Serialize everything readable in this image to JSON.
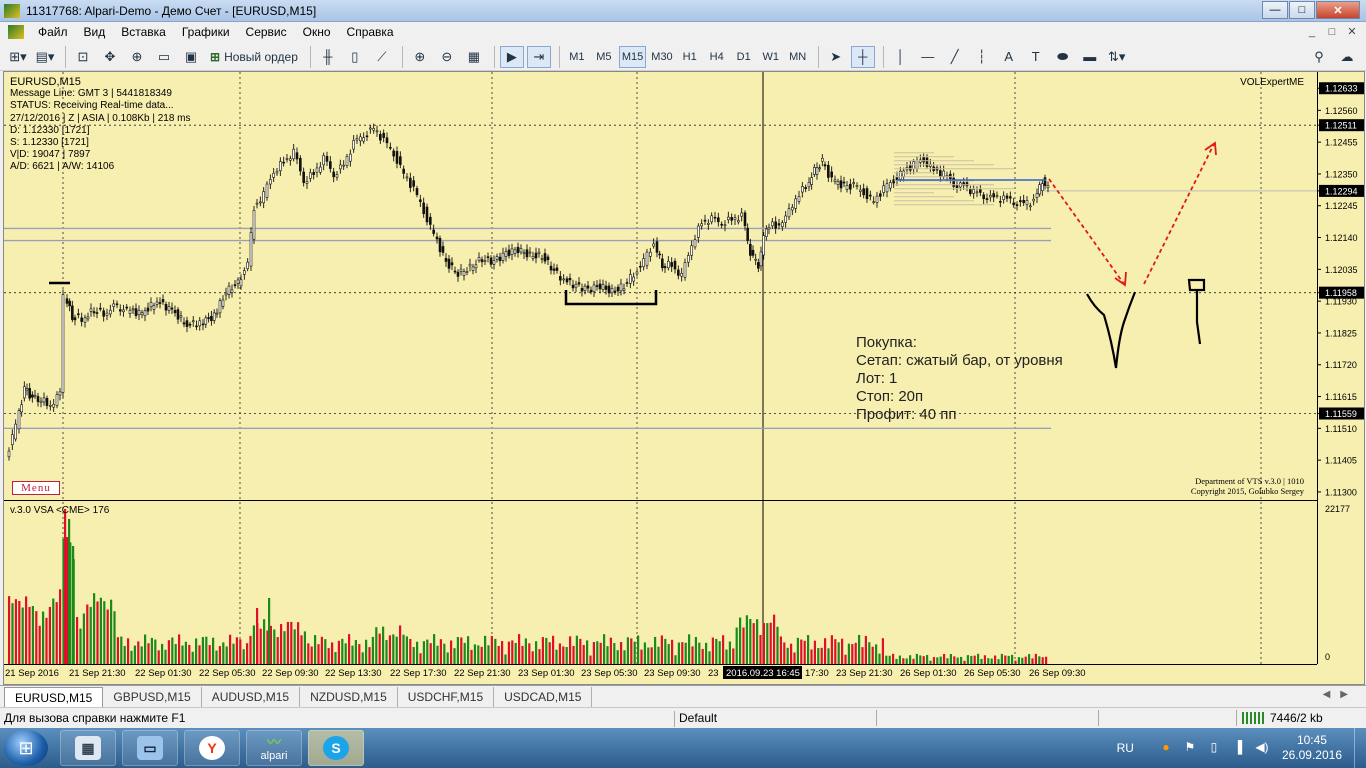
{
  "window": {
    "title": "11317768: Alpari-Demo - Демо Счет - [EURUSD,M15]",
    "btn_min": "—",
    "btn_max": "□",
    "btn_close": "✕"
  },
  "menu": [
    "Файл",
    "Вид",
    "Вставка",
    "Графики",
    "Сервис",
    "Окно",
    "Справка"
  ],
  "mdi_buttons": [
    "_",
    "□",
    "✕"
  ],
  "toolbar": {
    "new_order": "Новый ордер",
    "timeframes": [
      "M1",
      "M5",
      "M15",
      "M30",
      "H1",
      "H4",
      "D1",
      "W1",
      "MN"
    ],
    "active_timeframe": "M15"
  },
  "chart": {
    "symbol_label": "EURUSD,M15",
    "info_lines": [
      "Message Line: GMT 3  | 5441818349",
      "STATUS:  Receiving Real-time data...",
      "27/12/2016 | Z | ASIA | 0.108Kb | 218 ms",
      "D: 1.12330  [1721]",
      "S: 1.12330  [1721]",
      "V|D: 19047 | 7897",
      "A/D: 6621  | A/W: 14106"
    ],
    "expert_label": "VOLExpertME",
    "menu_button": "Menu",
    "dept_line1": "Department of VTS  v.3.0 | 1010",
    "dept_line2": "Copyright 2015, Golubko Sergey",
    "trade_note": [
      "Покупка:",
      "Сетап: сжатый бар, от уровня",
      "Лот: 1",
      "Стоп: 20п",
      "Профит: 40 пп"
    ],
    "indicator_label": "v.3.0 VSA  <CME> 176",
    "price_labels": [
      "1.12633",
      "1.12560",
      "1.12511",
      "1.12455",
      "1.12350",
      "1.12294",
      "1.12245",
      "1.12140",
      "1.12035",
      "1.11958",
      "1.11930",
      "1.11825",
      "1.11720",
      "1.11615",
      "1.11559",
      "1.11510",
      "1.11405",
      "1.11300"
    ],
    "highlighted_prices": [
      "1.12633",
      "1.12511",
      "1.12294",
      "1.11958",
      "1.11559"
    ],
    "volume_labels": [
      "22177",
      "0"
    ],
    "time_labels": [
      "21 Sep 2016",
      "21 Sep 21:30",
      "22 Sep 01:30",
      "22 Sep 05:30",
      "22 Sep 09:30",
      "22 Sep 13:30",
      "22 Sep 17:30",
      "22 Sep 21:30",
      "23 Sep 01:30",
      "23 Sep 05:30",
      "23 Sep 09:30",
      "23",
      "17:30",
      "23 Sep 21:30",
      "26 Sep 01:30",
      "26 Sep 05:30",
      "26 Sep 09:30"
    ],
    "crosshair_time": "2016.09.23 16:45",
    "colors": {
      "bg": "#f7efaf",
      "up_volume": "#1a8a1a",
      "down_volume": "#e0102a",
      "arrow": "#e01818"
    }
  },
  "tabs": [
    "EURUSD,M15",
    "GBPUSD,M15",
    "AUDUSD,M15",
    "NZDUSD,M15",
    "USDCHF,M15",
    "USDCAD,M15"
  ],
  "status": {
    "help": "Для вызова справки нажмите F1",
    "profile": "Default",
    "connection": "7446/2 kb"
  },
  "taskbar": {
    "apps": [
      "calculator-icon",
      "computer-icon",
      "yandex-icon",
      "alpari-icon",
      "skype-icon"
    ],
    "alpari_label": "alpari",
    "lang": "RU",
    "time": "10:45",
    "date": "26.09.2016"
  }
}
